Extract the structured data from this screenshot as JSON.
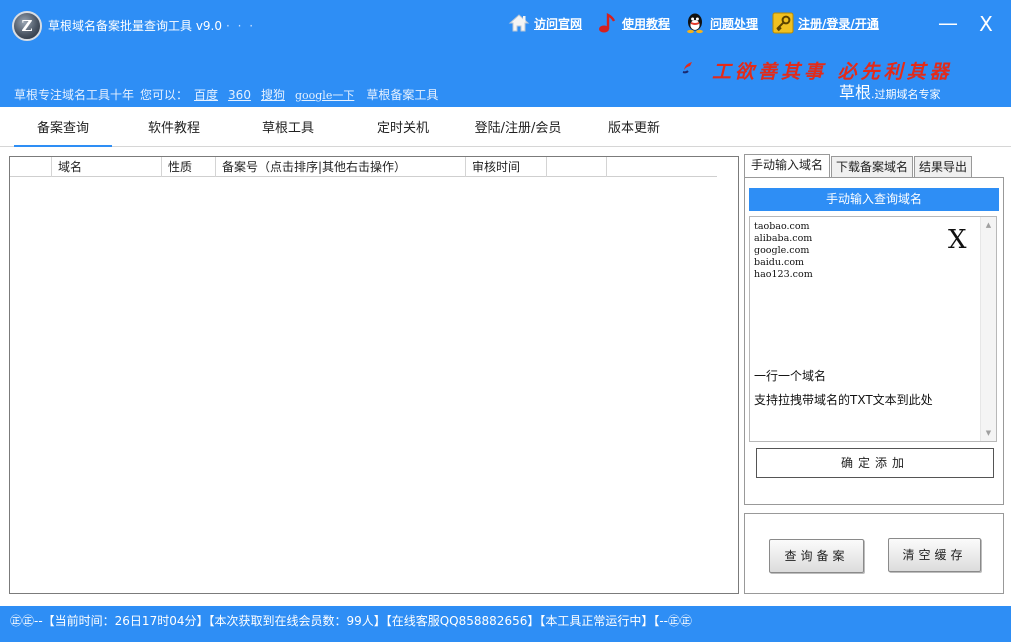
{
  "window": {
    "title": "草根域名备案批量查询工具 v9.0",
    "title_dots": "· · ·",
    "minimize_glyph": "—",
    "close_glyph": "X"
  },
  "header": {
    "logo_letter": "Z",
    "links": [
      {
        "label": "访问官网",
        "icon": "home-icon"
      },
      {
        "label": "使用教程",
        "icon": "music-note-icon"
      },
      {
        "label": "问题处理",
        "icon": "qq-penguin-icon"
      },
      {
        "label": "注册/登录/开通",
        "icon": "key-icon"
      }
    ],
    "slogan": "工欲善其事 必先利其器",
    "brand_big": "草根",
    "brand_small": ".过期域名专家",
    "subline": {
      "lead": "草根专注域名工具十年",
      "prompt": "您可以：",
      "links": [
        "百度",
        "360",
        "搜狗",
        "google一下"
      ],
      "tail": "草根备案工具"
    }
  },
  "tabs": [
    "备案查询",
    "软件教程",
    "草根工具",
    "定时关机",
    "登陆/注册/会员",
    "版本更新"
  ],
  "active_tab": 0,
  "table": {
    "columns": [
      "",
      "域名",
      "性质",
      "备案号（点击排序|其他右击操作）",
      "审核时间",
      ""
    ],
    "rows": []
  },
  "right_panel": {
    "tabs": [
      "手动输入域名",
      "下载备案域名",
      "结果导出"
    ],
    "active_tab": 0,
    "heading": "手动输入查询域名",
    "textarea_lines": [
      "taobao.com",
      "alibaba.com",
      "google.com",
      "baidu.com",
      "hao123.com"
    ],
    "clear_glyph": "X",
    "hint_one_per_line": "一行一个域名",
    "hint_drag_txt": "支持拉拽带域名的TXT文本到此处",
    "add_button": "确定添加",
    "query_button": "查询备案",
    "clear_cache_button": "清空缓存"
  },
  "status_bar": {
    "text": "㊣㊣--【当前时间：26日17时04分】【本次获取到在线会员数：99人】【在线客服QQ858882656】【本工具正常运行中】【--㊣㊣"
  },
  "colors": {
    "accent": "#2e8ef5",
    "slogan": "#e22b1a"
  }
}
